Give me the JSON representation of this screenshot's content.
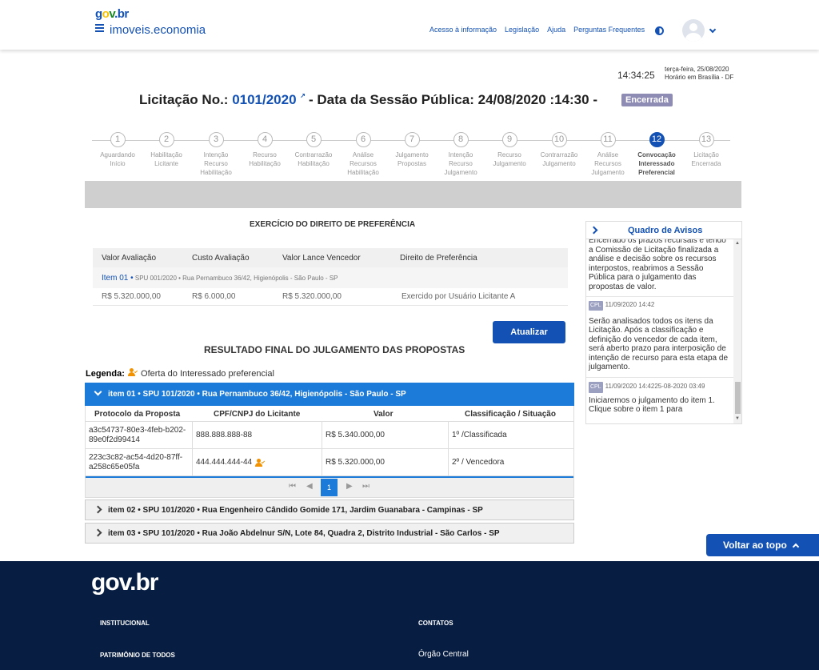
{
  "header": {
    "logo": {
      "g": "g",
      "o": "o",
      "v": "v",
      "br": ".br"
    },
    "site_title": "imoveis.economia",
    "links": [
      "Acesso à informação",
      "Legislação",
      "Ajuda",
      "Perguntas Frequentes"
    ]
  },
  "clock": {
    "time": "14:34:25",
    "weekday_date": "terça-feira, 25/08/2020",
    "timezone": "Horário em Brasília - DF"
  },
  "title": {
    "prefix": "Licitação No.: ",
    "number": "0101/2020",
    "ext_icon": "↗",
    "session_label": "- Data da Sessão Pública: 24/08/2020 :",
    "time": "14:30",
    "dash": " -",
    "status": "Encerrada"
  },
  "steps": [
    {
      "n": "1",
      "label": "Aguardando Início"
    },
    {
      "n": "2",
      "label": "Habilitação Licitante"
    },
    {
      "n": "3",
      "label": "Intenção Recurso Habilitação"
    },
    {
      "n": "4",
      "label": "Recurso Habilitação"
    },
    {
      "n": "5",
      "label": "Contrarrazão Habilitação"
    },
    {
      "n": "6",
      "label": "Análise Recursos Habilitação"
    },
    {
      "n": "7",
      "label": "Julgamento Propostas"
    },
    {
      "n": "8",
      "label": "Intenção Recurso Julgamento"
    },
    {
      "n": "9",
      "label": "Recurso Julgamento"
    },
    {
      "n": "10",
      "label": "Contrarrazão Julgamento"
    },
    {
      "n": "11",
      "label": "Análise Recursos Julgamento"
    },
    {
      "n": "12",
      "label": "Convocação Interessado Preferencial"
    },
    {
      "n": "13",
      "label": "Licitação Encerrada"
    }
  ],
  "active_step": 12,
  "preference": {
    "title": "EXERCÍCIO DO DIREITO DE PREFERÊNCIA",
    "headers": [
      "Valor Avaliação",
      "Custo Avaliação",
      "Valor Lance Vencedor",
      "Direito de Preferência"
    ],
    "item_label": "Item 01 •",
    "item_address": " SPU 001/2020 • Rua Pernambuco 36/42, Higienópolis - São Paulo - SP",
    "values": [
      "R$ 5.320.000,00",
      "R$ 6.000,00",
      "R$ 5.320.000,00",
      "Exercido por Usuário Licitante A"
    ]
  },
  "update_button": "Atualizar",
  "result": {
    "title": "RESULTADO FINAL DO JULGAMENTO DAS PROPOSTAS",
    "legend_label": "Legenda:",
    "legend_text": "Oferta do Interessado preferencial",
    "open_item": "item 01 • SPU 101/2020 • Rua Pernambuco 36/42, Higienópolis - São Paulo - SP",
    "headers": [
      "Protocolo da Proposta",
      "CPF/CNPJ do Licitante",
      "Valor",
      "Classificação / Situação"
    ],
    "rows": [
      {
        "protocol": "a3c54737-80e3-4feb-b202-89e0f2d99414",
        "cpf": "888.888.888-88",
        "value": "R$ 5.340.000,00",
        "status": "1º /Classificada"
      },
      {
        "protocol": "223c3c82-ac54-4d20-87ff-a258c65e05fa",
        "cpf": "444.444.444-44",
        "value": "R$ 5.320.000,00",
        "status": "2º / Vencedora"
      }
    ],
    "pager": {
      "first": "⏮",
      "prev": "◀",
      "current": "1",
      "next": "▶",
      "last": "⏭"
    },
    "closed_items": [
      "item 02 • SPU 101/2020 • Rua Engenheiro Cândido Gomide 171, Jardim Guanabara - Campinas - SP",
      "item 03 • SPU 101/2020 • Rua João Abdelnur S/N, Lote 84, Quadra 2, Distrito Industrial - São Carlos - SP"
    ]
  },
  "notices": {
    "title": "Quadro de Avisos",
    "intro": "Encerrado os prazos recursais e tendo a Comissão de Licitação finalizada a análise e decisão sobre os recursos interpostos, reabrimos a Sessão Pública para o julgamento das propostas de valor.",
    "items": [
      {
        "tag": "CPL",
        "date": "11/09/2020 14:42",
        "text": "Serão analisados todos os itens da Licitação. Após a classificação e definição do vencedor de cada item, será aberto prazo para interposição de intenção de recurso para esta etapa de julgamento."
      },
      {
        "tag": "CPL",
        "date": "11/09/2020 14:4225-08-2020 03:49",
        "text": "Iniciaremos o julgamento do item 1. Clique sobre o item 1 para"
      }
    ],
    "scroll_up": "▲",
    "scroll_down": "▼"
  },
  "back_to_top": "Voltar ao topo",
  "footer": {
    "logo": "gov.br",
    "col1": [
      "INSTITUCIONAL",
      "PATRIMÔNIO DE TODOS"
    ],
    "col2_title": "CONTATOS",
    "col2_link": "Órgão Central"
  },
  "colors": {
    "primary": "#1351b4",
    "accent": "#1c7ad9",
    "footer": "#071d41",
    "preferred": "#f29200"
  }
}
